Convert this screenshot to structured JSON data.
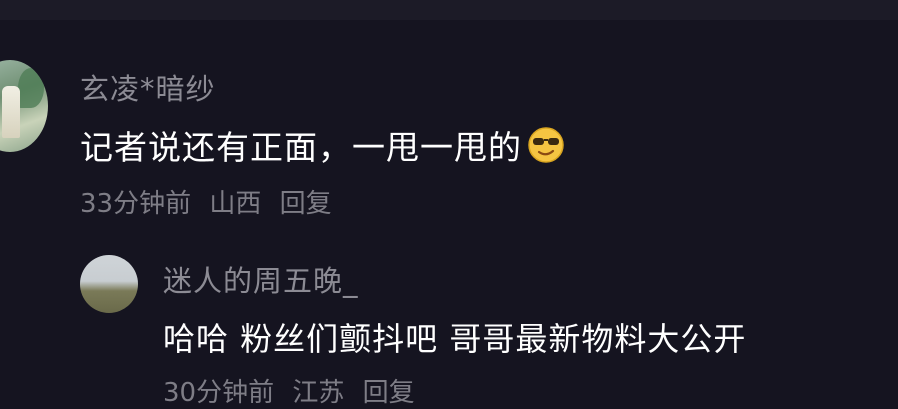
{
  "comment": {
    "username": "玄凌*暗纱",
    "text": "记者说还有正面，一甩一甩的",
    "emoji_icon": "smug-sunglasses-face-icon",
    "time": "33分钟前",
    "location": "山西",
    "reply_label": "回复"
  },
  "reply": {
    "username": "迷人的周五晚_",
    "text": "哈哈 粉丝们颤抖吧 哥哥最新物料大公开",
    "time": "30分钟前",
    "location": "江苏",
    "reply_label": "回复"
  },
  "colors": {
    "background": "#151420",
    "username": "#8c8b94",
    "text": "#ffffff",
    "meta": "#7e7d86",
    "emoji": "#f5c542"
  }
}
